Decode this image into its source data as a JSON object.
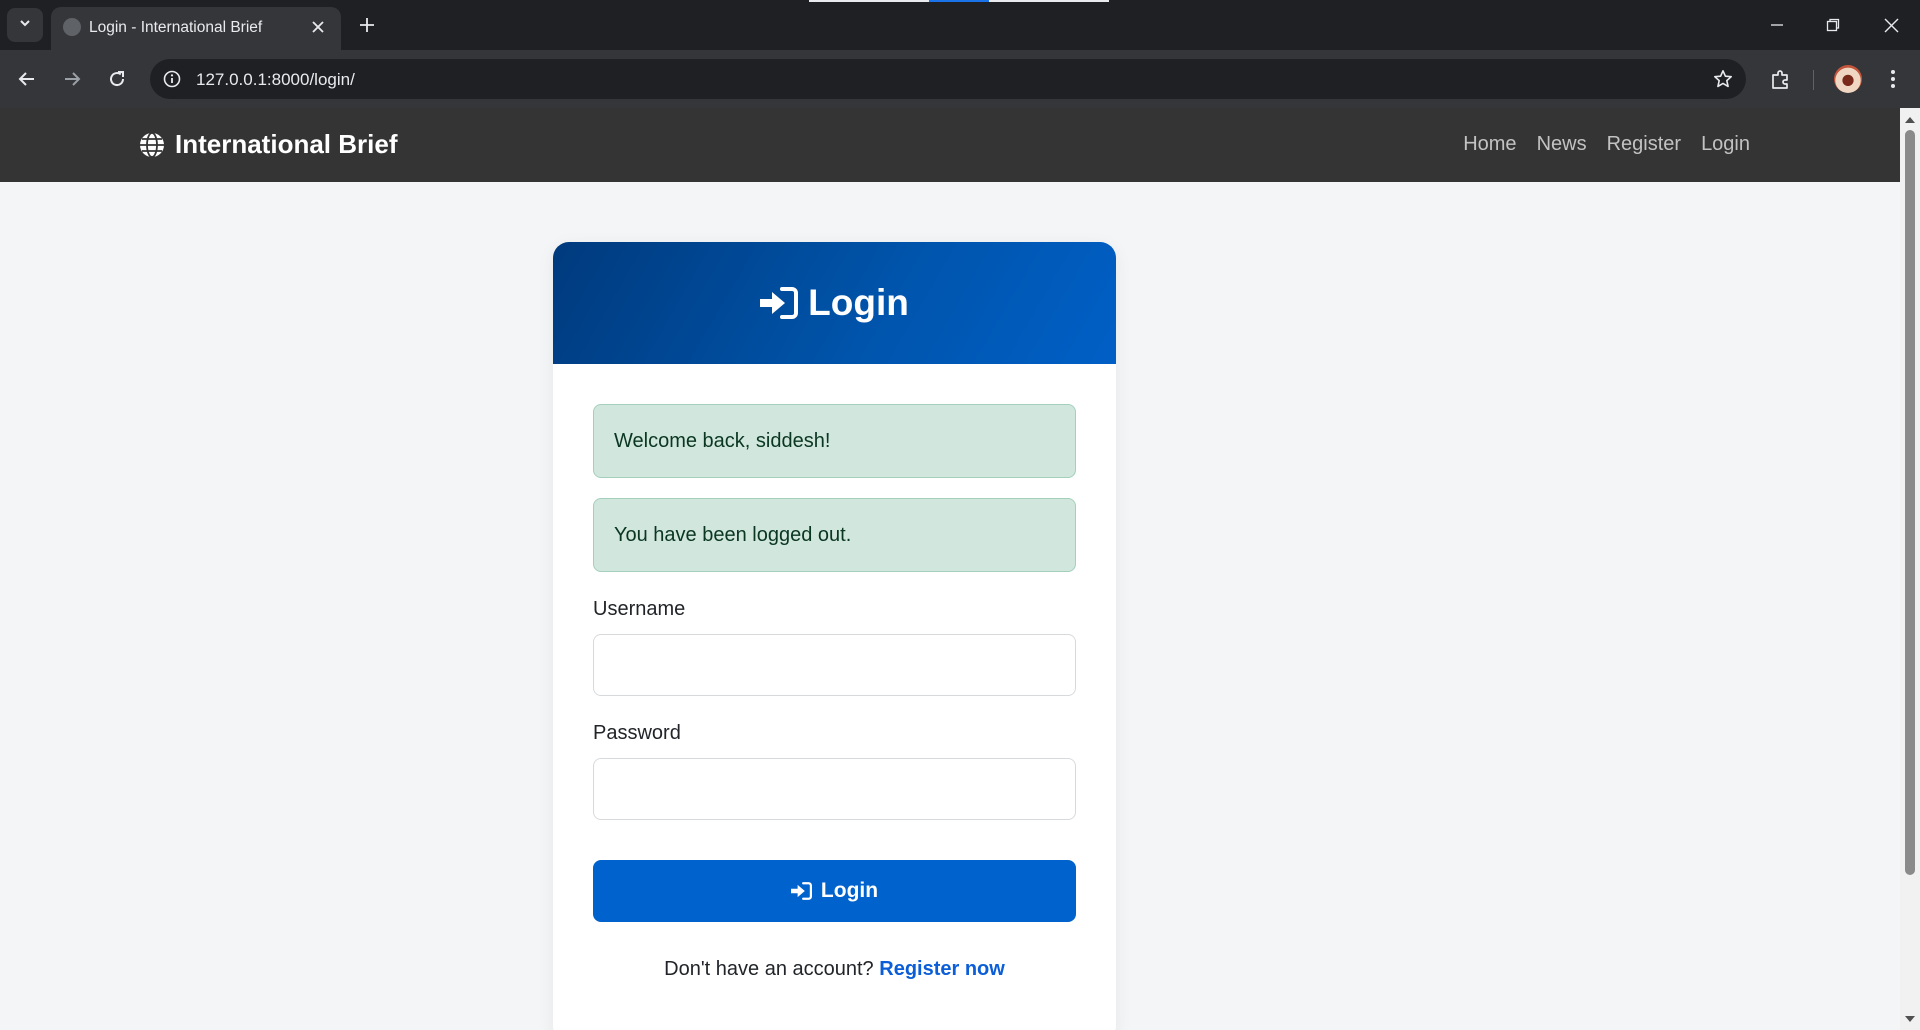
{
  "browser": {
    "tab_title": "Login - International Brief",
    "url": "127.0.0.1:8000/login/",
    "icons": [
      "tab-list-icon",
      "close-icon",
      "plus-icon",
      "minimize-icon",
      "restore-icon",
      "window-close-icon",
      "back-arrow-icon",
      "forward-arrow-icon",
      "reload-icon",
      "info-icon",
      "star-icon",
      "extensions-icon",
      "kebab-menu-icon"
    ]
  },
  "site": {
    "brand": "International Brief",
    "nav": {
      "home": "Home",
      "news": "News",
      "register": "Register",
      "login": "Login"
    }
  },
  "login_card": {
    "title": "Login",
    "alerts": [
      "Welcome back, siddesh!",
      "You have been logged out."
    ],
    "username_label": "Username",
    "username_value": "",
    "password_label": "Password",
    "password_value": "",
    "submit_label": "Login",
    "register_prompt": "Don't have an account?",
    "register_link": "Register now"
  },
  "colors": {
    "header_gradient_start": "#003a7d",
    "header_gradient_end": "#005fc6",
    "primary_button": "#0062cc",
    "alert_success_bg": "#d1e7dd",
    "navbar_bg": "#343434",
    "link": "#0b5ed7"
  }
}
